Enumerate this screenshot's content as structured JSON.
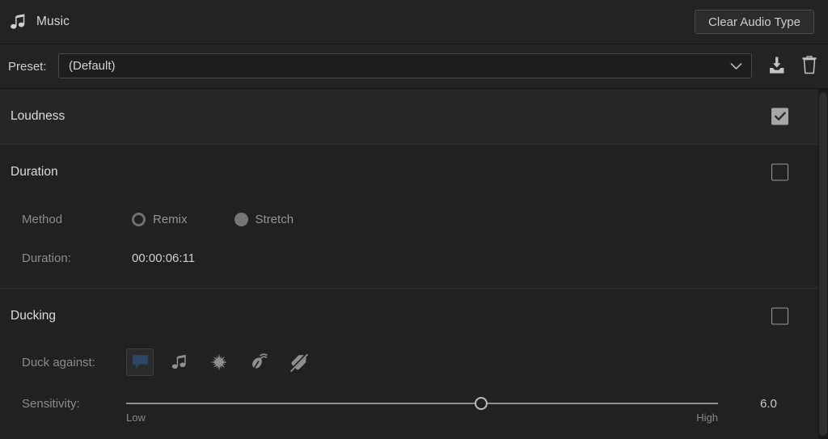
{
  "header": {
    "icon": "music-note-icon",
    "title": "Music",
    "clear_button_label": "Clear Audio Type"
  },
  "preset": {
    "label": "Preset:",
    "value": "(Default)",
    "placeholder": "(Default)",
    "chevron": "chevron-down-icon",
    "save_icon": "save-preset-icon",
    "delete_icon": "trash-icon"
  },
  "sections": {
    "loudness": {
      "title": "Loudness",
      "checked": true
    },
    "duration": {
      "title": "Duration",
      "checked": false,
      "method_label": "Method",
      "method_options": [
        {
          "label": "Remix",
          "selected": false
        },
        {
          "label": "Stretch",
          "selected": true
        }
      ],
      "duration_label": "Duration:",
      "duration_value": "00:00:06:11"
    },
    "ducking": {
      "title": "Ducking",
      "checked": false,
      "duck_against_label": "Duck against:",
      "duck_against_options": [
        {
          "name": "dialogue-icon",
          "selected": true
        },
        {
          "name": "music-icon",
          "selected": false
        },
        {
          "name": "sfx-icon",
          "selected": false
        },
        {
          "name": "ambience-icon",
          "selected": false
        },
        {
          "name": "no-audio-type-icon",
          "selected": false
        }
      ],
      "sensitivity_label": "Sensitivity:",
      "sensitivity_min_label": "Low",
      "sensitivity_max_label": "High",
      "sensitivity_value": "6.0",
      "sensitivity_percent": 60
    }
  },
  "colors": {
    "accent_selected": "#2e4868",
    "panel_bg": "#212121",
    "row_bg": "#262626",
    "header_bg": "#232323"
  }
}
